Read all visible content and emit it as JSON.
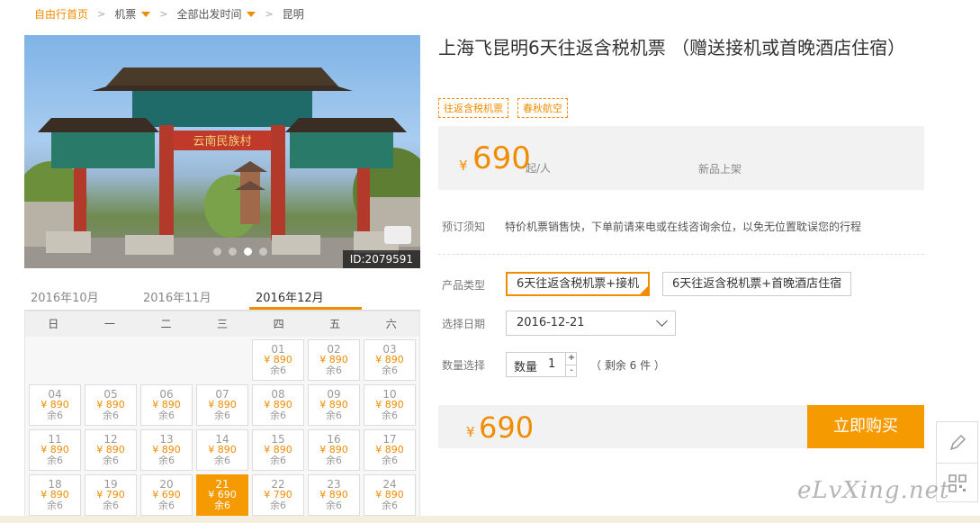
{
  "breadcrumb": {
    "home": "自由行首页",
    "category": "机票",
    "departure": "全部出发时间",
    "destination": "昆明"
  },
  "photo": {
    "id_label": "ID:2079591",
    "dots": 4,
    "active_dot": 3
  },
  "months": [
    "2016年10月",
    "2016年11月",
    "2016年12月"
  ],
  "active_month": 2,
  "weekdays": [
    "日",
    "一",
    "二",
    "三",
    "四",
    "五",
    "六"
  ],
  "calendar": [
    {
      "day": "01",
      "price": "¥ 890",
      "stock": "余6"
    },
    {
      "day": "02",
      "price": "¥ 890",
      "stock": "余6"
    },
    {
      "day": "03",
      "price": "¥ 890",
      "stock": "余6"
    },
    {
      "day": "04",
      "price": "¥ 890",
      "stock": "余6"
    },
    {
      "day": "05",
      "price": "¥ 890",
      "stock": "余6"
    },
    {
      "day": "06",
      "price": "¥ 890",
      "stock": "余6"
    },
    {
      "day": "07",
      "price": "¥ 890",
      "stock": "余6"
    },
    {
      "day": "08",
      "price": "¥ 890",
      "stock": "余6"
    },
    {
      "day": "09",
      "price": "¥ 890",
      "stock": "余6"
    },
    {
      "day": "10",
      "price": "¥ 890",
      "stock": "余6"
    },
    {
      "day": "11",
      "price": "¥ 890",
      "stock": "余6"
    },
    {
      "day": "12",
      "price": "¥ 890",
      "stock": "余6"
    },
    {
      "day": "13",
      "price": "¥ 890",
      "stock": "余6"
    },
    {
      "day": "14",
      "price": "¥ 890",
      "stock": "余6"
    },
    {
      "day": "15",
      "price": "¥ 890",
      "stock": "余6"
    },
    {
      "day": "16",
      "price": "¥ 890",
      "stock": "余6"
    },
    {
      "day": "17",
      "price": "¥ 890",
      "stock": "余6"
    },
    {
      "day": "18",
      "price": "¥ 890",
      "stock": "余6"
    },
    {
      "day": "19",
      "price": "¥ 790",
      "stock": "余6"
    },
    {
      "day": "20",
      "price": "¥ 690",
      "stock": "余6"
    },
    {
      "day": "21",
      "price": "¥ 690",
      "stock": "余6",
      "selected": true
    },
    {
      "day": "22",
      "price": "¥ 790",
      "stock": "余6"
    },
    {
      "day": "23",
      "price": "¥ 890",
      "stock": "余6"
    },
    {
      "day": "24",
      "price": "¥ 890",
      "stock": "余6"
    }
  ],
  "product": {
    "title": "上海飞昆明6天往返含税机票 （赠送接机或首晚酒店住宿）",
    "tags": [
      "往返含税机票",
      "春秋航空"
    ],
    "currency": "¥",
    "price": "690",
    "price_unit": "起/人",
    "status": "新品上架",
    "notice_label": "预订须知",
    "notice_text": "特价机票销售快，下单前请来电或在线咨询余位，以免无位置耽误您的行程",
    "type_label": "产品类型",
    "types": [
      "6天往返含税机票+接机",
      "6天往返含税机票+首晚酒店住宿"
    ],
    "active_type": 0,
    "date_label": "选择日期",
    "date_value": "2016-12-21",
    "qty_label": "数量选择",
    "qty_name": "数量",
    "qty_value": "1",
    "qty_plus": "+",
    "qty_minus": "-",
    "remain_text": "（ 剩余 6 件 ）",
    "total_price": "690",
    "buy_label": "立即购买"
  },
  "watermark": "eLvXing.net",
  "colors": {
    "accent": "#f08c00",
    "button": "#f59a00"
  }
}
